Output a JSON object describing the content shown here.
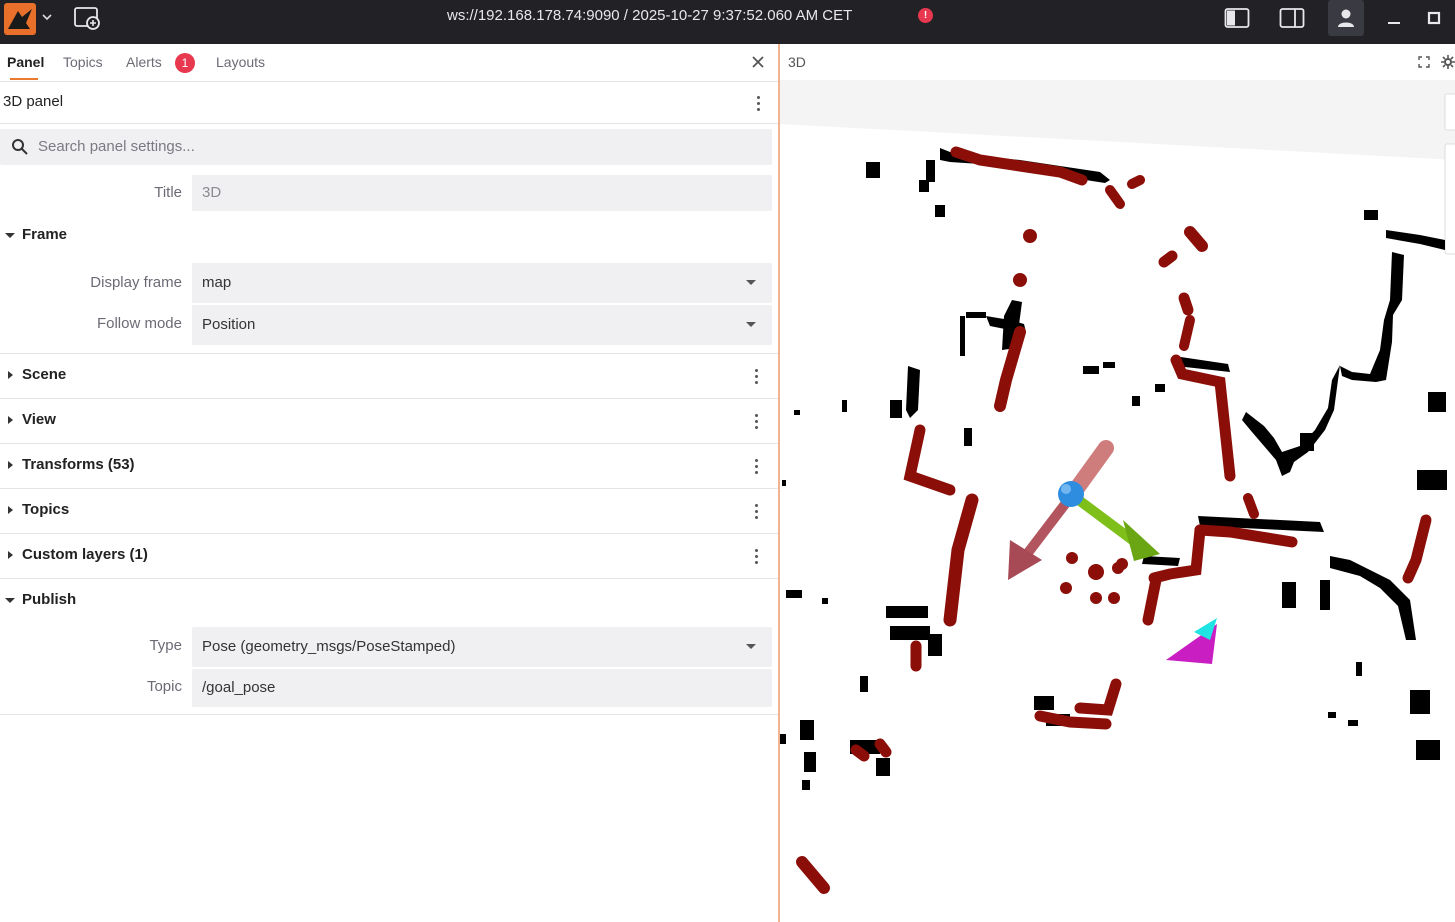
{
  "titlebar": {
    "connection": "ws://192.168.178.74:9090 / 2025-10-27 9:37:52.060 AM CET",
    "connection_status_mark": "!"
  },
  "sidebar_tabs": [
    {
      "label": "Panel"
    },
    {
      "label": "Topics"
    },
    {
      "label": "Alerts"
    },
    {
      "label": "Layouts"
    }
  ],
  "alerts_count": "1",
  "panel": {
    "title": "3D panel",
    "search_placeholder": "Search panel settings..."
  },
  "fields": {
    "title_label": "Title",
    "title_value": "3D",
    "display_frame_label": "Display frame",
    "display_frame_value": "map",
    "follow_mode_label": "Follow mode",
    "follow_mode_value": "Position",
    "type_label": "Type",
    "type_value": "Pose (geometry_msgs/PoseStamped)",
    "topic_label": "Topic",
    "topic_value": "/goal_pose"
  },
  "sections": {
    "frame": "Frame",
    "scene": "Scene",
    "view": "View",
    "transforms": "Transforms (53)",
    "topics": "Topics",
    "custom_layers": "Custom layers (1)",
    "publish": "Publish"
  },
  "viewport": {
    "title": "3D"
  },
  "icons": {
    "logo": "foxglove-logo-icon",
    "add_panel": "add-panel-icon",
    "left_sidebar": "left-sidebar-icon",
    "right_sidebar": "right-sidebar-icon",
    "user": "user-icon",
    "minimize": "minimize-icon",
    "maximize": "maximize-icon"
  },
  "colors": {
    "titlebar": "#212126",
    "accent": "#ea7a2f",
    "alert": "#e8384f",
    "laser": "#8b0f08",
    "map_obstacle": "#000000"
  }
}
